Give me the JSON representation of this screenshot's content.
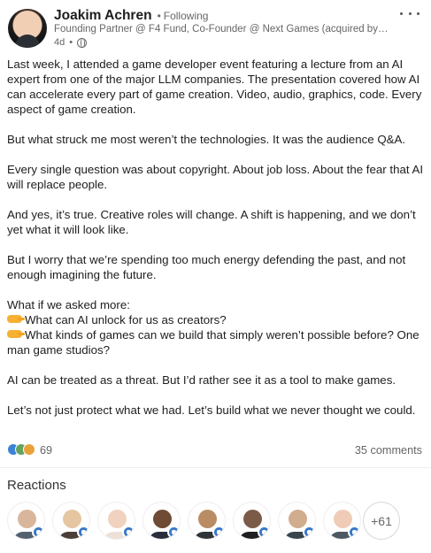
{
  "post": {
    "author": {
      "name": "Joakim Achren",
      "follow_separator": "•",
      "follow_state": "Following",
      "headline": "Founding Partner @ F4 Fund, Co-Founder @ Next Games (acquired by N...",
      "age": "4d",
      "age_separator": "•",
      "visibility_icon": "globe-icon"
    },
    "more_icon": "more-horizontal-icon",
    "body": [
      {
        "type": "text",
        "text": "Last week, I attended a game developer event featuring a lecture from an AI"
      },
      {
        "type": "text",
        "text": "expert from one of the major LLM companies. The presentation covered how AI"
      },
      {
        "type": "text",
        "text": "can accelerate every part of game creation. Video, audio, graphics, code. Every"
      },
      {
        "type": "text",
        "text": "aspect of game creation."
      },
      {
        "type": "blank",
        "text": ""
      },
      {
        "type": "text",
        "text": "But what struck me most weren’t the technologies. It was the audience Q&A."
      },
      {
        "type": "blank",
        "text": ""
      },
      {
        "type": "text",
        "text": "Every single question was about copyright. About job loss. About the fear that AI"
      },
      {
        "type": "text",
        "text": "will replace people."
      },
      {
        "type": "blank",
        "text": ""
      },
      {
        "type": "text",
        "text": "And yes, it’s true. Creative roles will change. A shift is happening, and we don’t"
      },
      {
        "type": "text",
        "text": "yet what it will look like."
      },
      {
        "type": "blank",
        "text": ""
      },
      {
        "type": "text",
        "text": "But I worry that we’re spending too much energy defending the past, and not"
      },
      {
        "type": "text",
        "text": "enough imagining the future."
      },
      {
        "type": "blank",
        "text": ""
      },
      {
        "type": "text",
        "text": "What if we asked more:"
      },
      {
        "type": "icon",
        "icon": "pointing-hand-icon",
        "text": "What can AI unlock for us as creators?"
      },
      {
        "type": "icon",
        "icon": "pointing-hand-icon",
        "text": "What kinds of games can we build that simply weren’t possible before? One"
      },
      {
        "type": "text",
        "text": "man game studios?"
      },
      {
        "type": "blank",
        "text": ""
      },
      {
        "type": "text",
        "text": "AI can be treated as a threat. But I’d rather see it as a tool to make games."
      },
      {
        "type": "blank",
        "text": ""
      },
      {
        "type": "text",
        "text": "Let’s not just protect what we had. Let’s build what we never thought we could."
      }
    ],
    "social": {
      "reaction_icons": [
        "like-reaction-icon",
        "celebrate-reaction-icon",
        "love-reaction-icon"
      ],
      "reaction_count": "69",
      "comments": "35 comments"
    }
  },
  "reactions": {
    "title": "Reactions",
    "people": [
      {
        "name": "reactor-1",
        "face": "#d8b69c",
        "body": "#536070"
      },
      {
        "name": "reactor-2",
        "face": "#e6c6a1",
        "body": "#4b3e36"
      },
      {
        "name": "reactor-3",
        "face": "#f0d2bf",
        "body": "#ede1d7"
      },
      {
        "name": "reactor-4",
        "face": "#6f4a35",
        "body": "#2a2d3c"
      },
      {
        "name": "reactor-5",
        "face": "#b98c64",
        "body": "#2f3438"
      },
      {
        "name": "reactor-6",
        "face": "#7b5a47",
        "body": "#1f1f22"
      },
      {
        "name": "reactor-7",
        "face": "#d0ad8d",
        "body": "#39434d"
      },
      {
        "name": "reactor-8",
        "face": "#f0ccb8",
        "body": "#4d5864"
      }
    ],
    "more_label": "+61",
    "reaction_badge_icon": "like-badge-icon"
  }
}
